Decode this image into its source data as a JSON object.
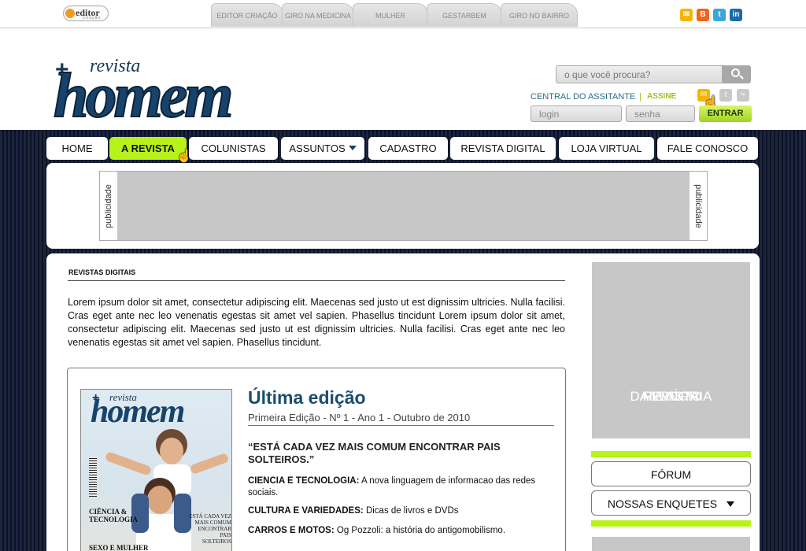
{
  "topbar": {
    "logo": {
      "name": "editor",
      "sub": "criação"
    },
    "site_tabs": [
      "EDITOR CRIAÇÃO",
      "GIRO NA MEDICINA",
      "MULHER",
      "GESTARBEM",
      "GIRO NO BAIRRO"
    ],
    "social_icons": [
      {
        "name": "mail-icon",
        "color": "#f5b400"
      },
      {
        "name": "blogger-icon",
        "color": "#f0641a"
      },
      {
        "name": "twitter-icon",
        "color": "#3aa7d6"
      },
      {
        "name": "linkedin-icon",
        "color": "#1d6aa8"
      }
    ]
  },
  "header": {
    "brand": {
      "plus": "+",
      "revista": "revista",
      "homem": "homem"
    },
    "search": {
      "placeholder": "o que você procura?"
    },
    "central": "CENTRAL DO ASSITANTE",
    "separator": "|",
    "assine": "ASSINE",
    "login": {
      "user_placeholder": "login",
      "password_placeholder": "senha",
      "submit": "ENTRAR"
    }
  },
  "nav": {
    "items": [
      "HOME",
      "A REVISTA",
      "COLUNISTAS",
      "ASSUNTOS",
      "CADASTRO",
      "REVISTA DIGITAL",
      "LOJA VIRTUAL",
      "FALE CONOSCO"
    ],
    "active": "A REVISTA"
  },
  "ad_banner": {
    "left_label": "publicidade",
    "right_label": "publicidade"
  },
  "main": {
    "section_title": "REVISTAS DIGITAIS",
    "intro": "Lorem ipsum dolor sit amet, consectetur adipiscing elit. Maecenas sed justo ut est dignissim ultricies. Nulla facilisi. Cras eget ante nec leo venenatis egestas sit amet vel sapien. Phasellus tincidunt Lorem ipsum dolor sit amet, consectetur adipiscing elit. Maecenas sed justo ut est dignissim ultricies. Nulla facilisi. Cras eget ante nec leo venenatis egestas sit amet vel sapien. Phasellus tincidunt.",
    "edition": {
      "title": "Última edição",
      "subtitle": "Primeira Edição - Nº 1 - Ano 1 - Outubro de 2010",
      "quote": "“ESTÁ CADA VEZ MAIS COMUM ENCONTRAR PAIS SOLTEIROS.”",
      "items": [
        {
          "label": "CIENCIA E TECNOLOGIA:",
          "text": "A nova linguagem de informacao das redes sociais."
        },
        {
          "label": "CULTURA E VARIEDADES:",
          "text": "Dicas de livros e DVDs"
        },
        {
          "label": "CARROS E MOTOS:",
          "text": "Og Pozzoli: a história do antigomobilismo."
        }
      ],
      "cover": {
        "plus": "+",
        "revista": "revista",
        "homem": "homem",
        "left_text_1": "CIÊNCIA &",
        "left_text_2": "TECNOLOGIA",
        "right_text_1": "ESTÁ CADA VEZ",
        "right_text_2": "MAIS COMUM",
        "right_text_3": "ENCONTRAR PAIS",
        "right_text_4": "SOLTEIROS",
        "bottom_text": "SEXO E MULHER"
      }
    }
  },
  "sidebar": {
    "anuncio_line1": "ANUNCIO",
    "anuncio_line2": "DA PRÓPRIA",
    "anuncio_line3": "REVISTA",
    "forum": "FÓRUM",
    "enquetes": "NOSSAS ENQUETES"
  },
  "colors": {
    "accent_green": "#b7f21a",
    "brand_blue": "#17436b",
    "link_teal": "#2a6e86"
  }
}
